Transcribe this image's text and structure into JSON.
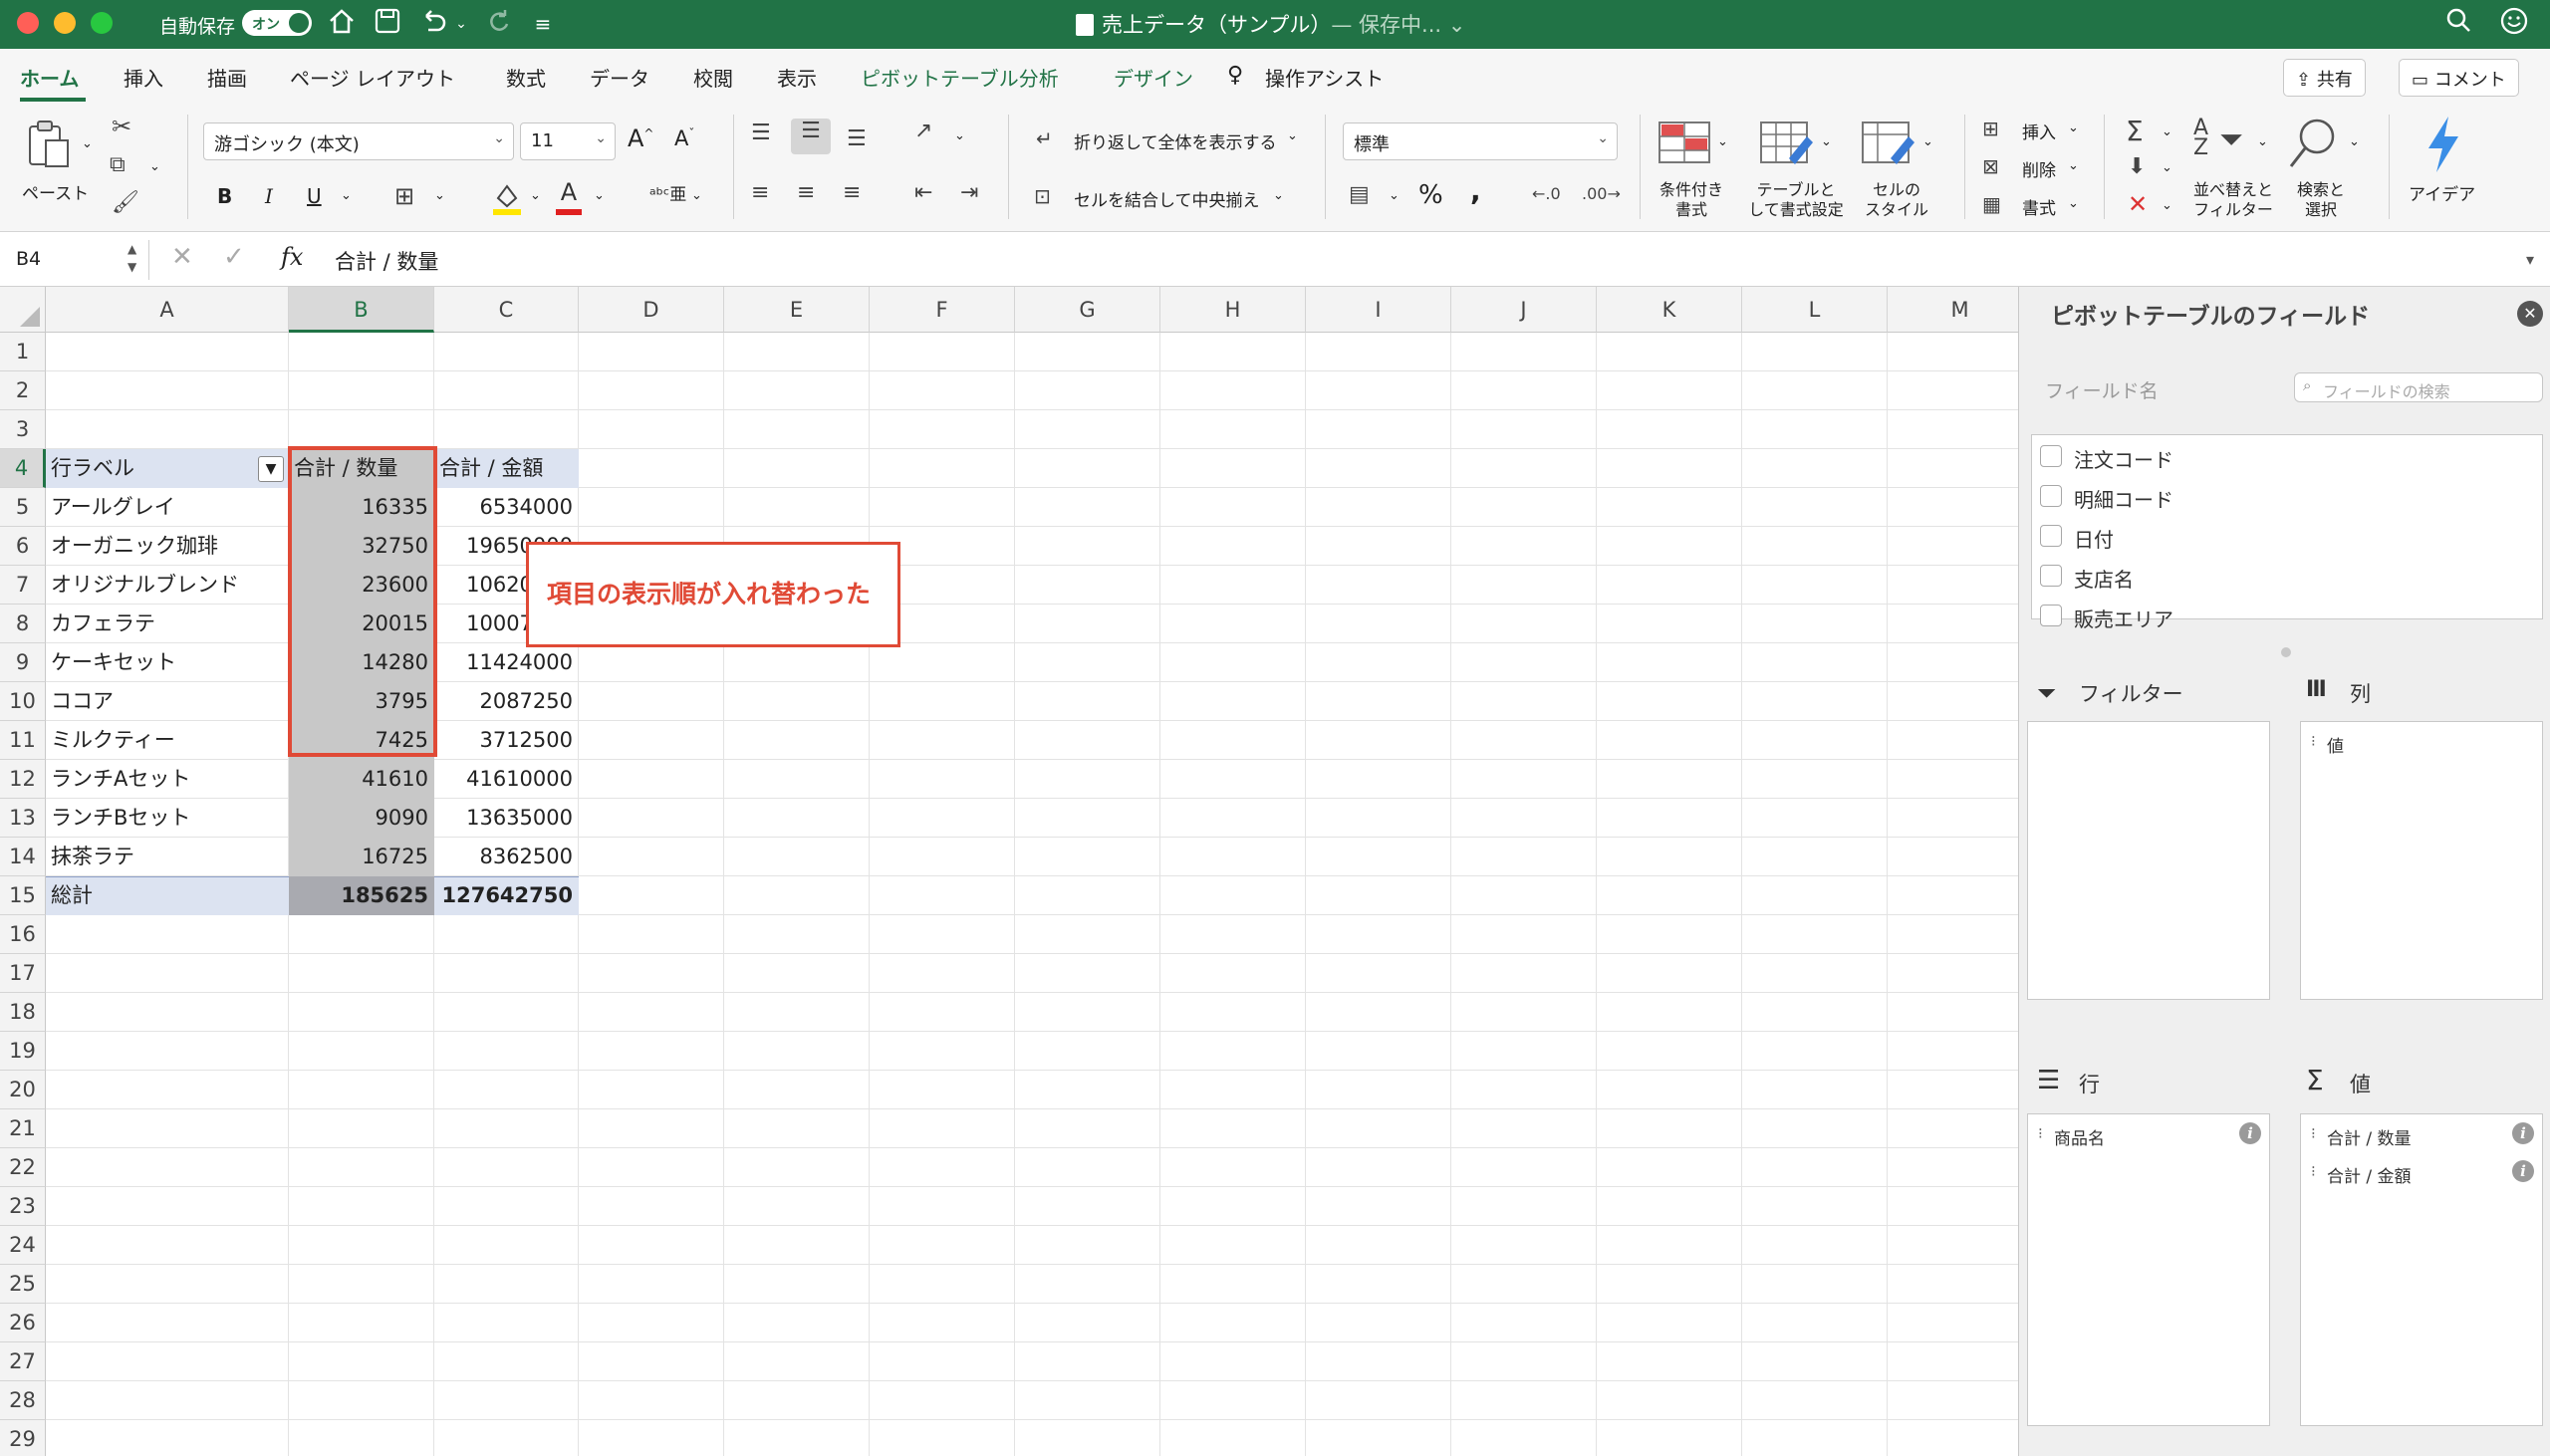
{
  "titlebar": {
    "autosave_label": "自動保存",
    "autosave_toggle": "オン",
    "filename": "売上データ（サンプル）",
    "status": "— 保存中...",
    "icons": [
      "close-icon",
      "minimize-icon",
      "zoom-icon",
      "home-icon",
      "save-icon",
      "undo-icon",
      "redo-icon",
      "customize-icon",
      "search-icon",
      "smiley-icon"
    ],
    "colors": {
      "bar": "#217346",
      "close": "#ff5f57",
      "minimize": "#febc2e",
      "zoom": "#28c840"
    }
  },
  "tabs": {
    "items": [
      "ホーム",
      "挿入",
      "描画",
      "ページ レイアウト",
      "数式",
      "データ",
      "校閲",
      "表示",
      "ピボットテーブル分析",
      "デザイン",
      "操作アシスト"
    ],
    "active": "ホーム",
    "share": "共有",
    "comment": "コメント"
  },
  "ribbon": {
    "paste": "ペースト",
    "font_name": "游ゴシック (本文)",
    "font_size": "11",
    "bold": "B",
    "italic": "I",
    "underline": "U",
    "wrap_text": "折り返して全体を表示する",
    "merge_center": "セルを結合して中央揃え",
    "number_format": "標準",
    "percent": "%",
    "comma": ",",
    "cond_format": [
      "条件付き",
      "書式"
    ],
    "table_format": [
      "テーブルと",
      "して書式設定"
    ],
    "cell_style": [
      "セルの",
      "スタイル"
    ],
    "insert": "挿入",
    "delete": "削除",
    "format": "書式",
    "sort_filter": [
      "並べ替えと",
      "フィルター"
    ],
    "find_select": [
      "検索と",
      "選択"
    ],
    "ideas": "アイデア"
  },
  "formula_bar": {
    "name_box": "B4",
    "fx": "fx",
    "content": "合計 / 数量"
  },
  "sheet": {
    "columns": [
      "A",
      "B",
      "C",
      "D",
      "E",
      "F",
      "G",
      "H",
      "I",
      "J",
      "K",
      "L",
      "M"
    ],
    "selected_column": "B",
    "rows": [
      "1",
      "2",
      "3",
      "4",
      "5",
      "6",
      "7",
      "8",
      "9",
      "10",
      "11",
      "12",
      "13",
      "14",
      "15",
      "16",
      "17",
      "18",
      "19",
      "20",
      "21",
      "22",
      "23",
      "24",
      "25",
      "26",
      "27",
      "28",
      "29"
    ],
    "selected_row": "4",
    "pivot": {
      "header": [
        "行ラベル",
        "合計 / 数量",
        "合計 / 金額"
      ],
      "rows": [
        [
          "アールグレイ",
          "16335",
          "6534000"
        ],
        [
          "オーガニック珈琲",
          "32750",
          "19650000"
        ],
        [
          "オリジナルブレンド",
          "23600",
          "10620000"
        ],
        [
          "カフェラテ",
          "20015",
          "10007500"
        ],
        [
          "ケーキセット",
          "14280",
          "11424000"
        ],
        [
          "ココア",
          "3795",
          "2087250"
        ],
        [
          "ミルクティー",
          "7425",
          "3712500"
        ],
        [
          "ランチAセット",
          "41610",
          "41610000"
        ],
        [
          "ランチBセット",
          "9090",
          "13635000"
        ],
        [
          "抹茶ラテ",
          "16725",
          "8362500"
        ]
      ],
      "total": [
        "総計",
        "185625",
        "127642750"
      ]
    },
    "callout": "項目の表示順が入れ替わった",
    "colors": {
      "pivot_header": "#dce3f1",
      "selection": "#c8c8c8",
      "annotation": "#e04a36"
    }
  },
  "pivot_panel": {
    "title": "ピボットテーブルのフィールド",
    "field_name_label": "フィールド名",
    "search_placeholder": "フィールドの検索",
    "fields": [
      "注文コード",
      "明細コード",
      "日付",
      "支店名",
      "販売エリア"
    ],
    "filter_label": "フィルター",
    "columns_label": "列",
    "columns_items": [
      "値"
    ],
    "rows_label": "行",
    "rows_items": [
      "商品名"
    ],
    "values_label": "値",
    "values_items": [
      "合計 / 数量",
      "合計 / 金額"
    ]
  }
}
